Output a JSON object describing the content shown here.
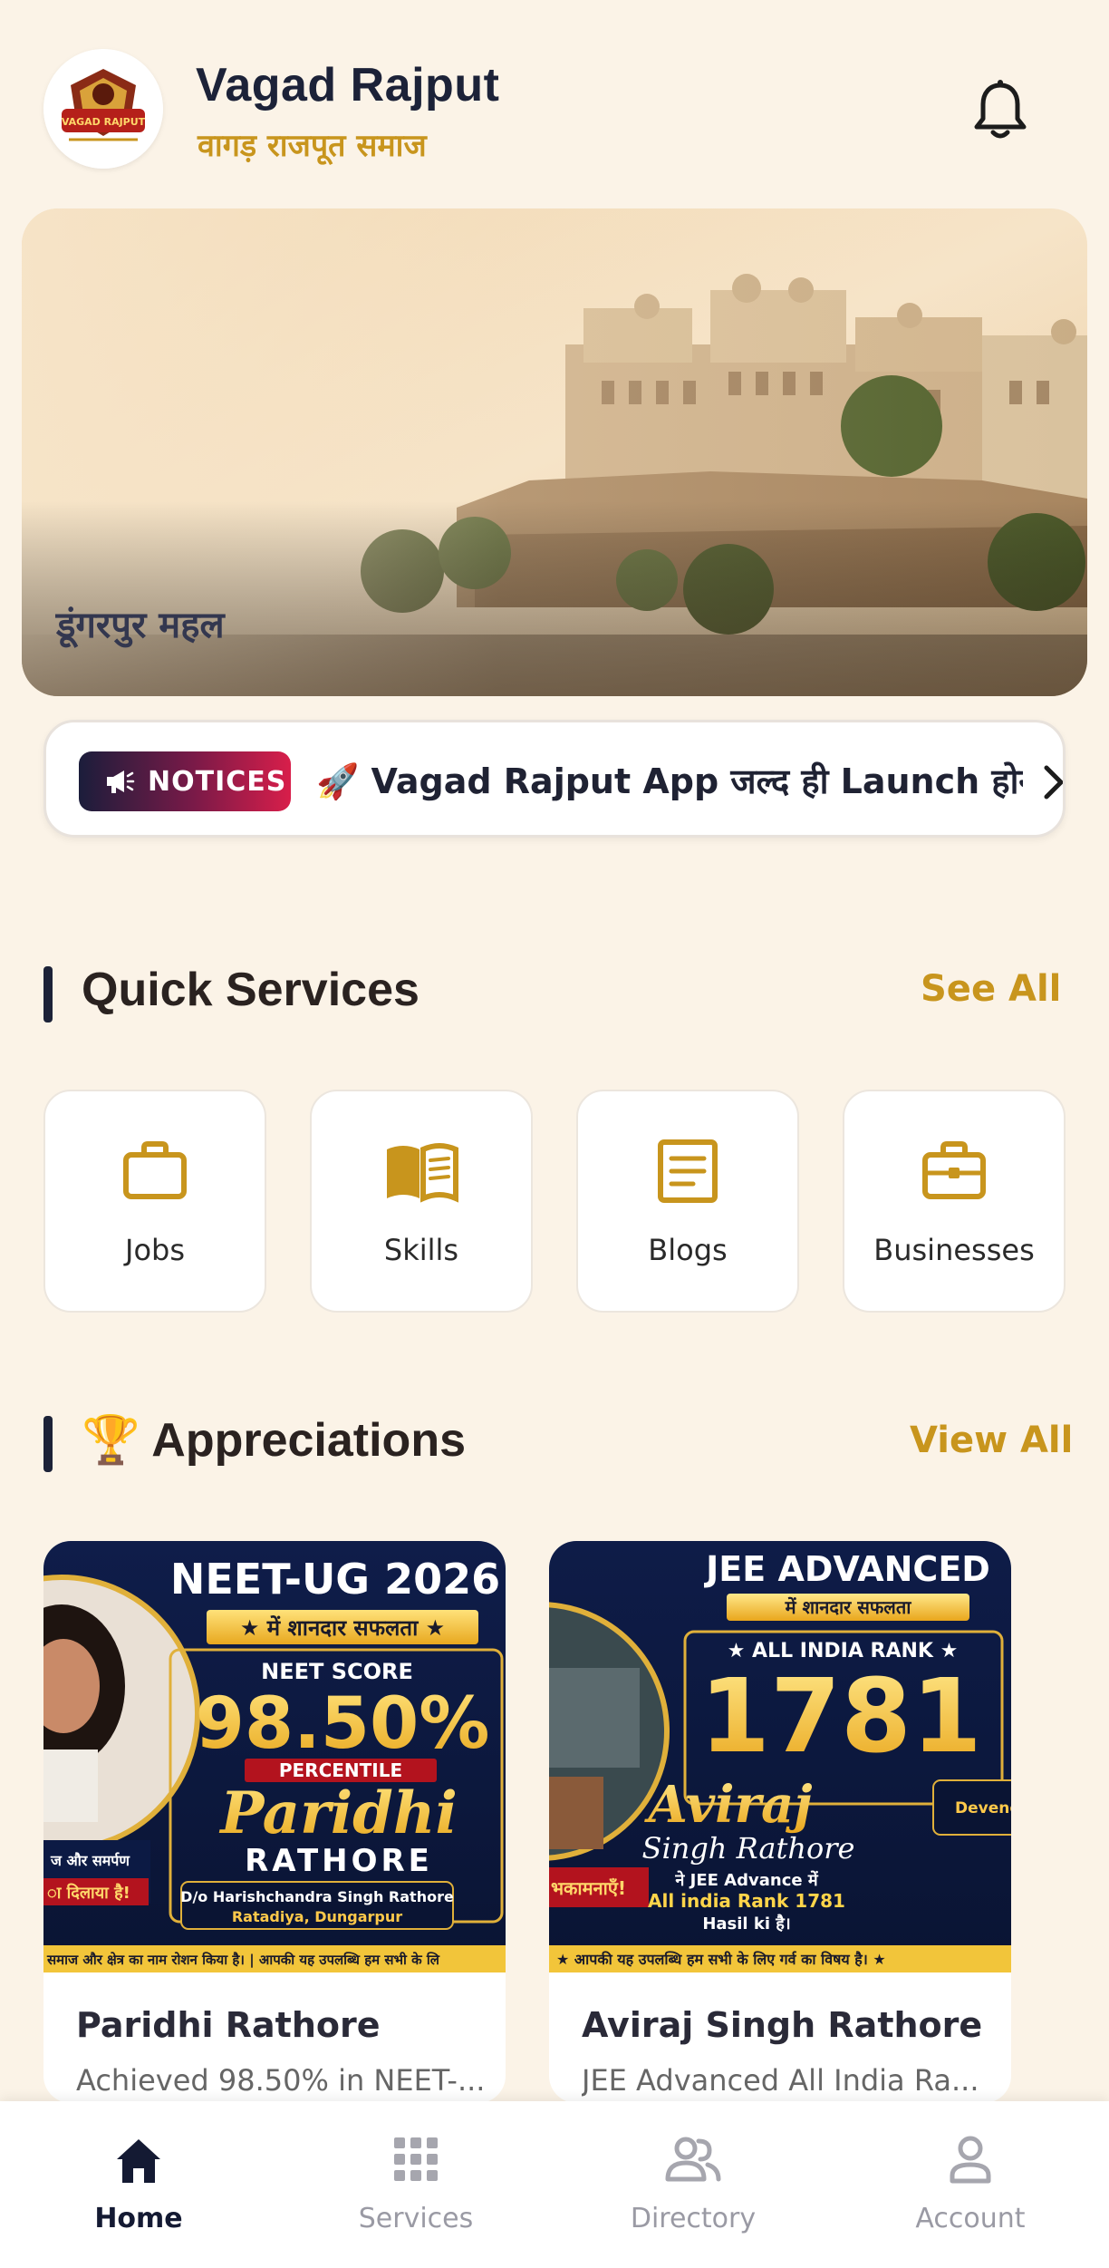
{
  "header": {
    "title": "Vagad Rajput",
    "subtitle": "वागड़ राजपूत समाज",
    "logo_text": "VAGAD RAJPUT",
    "notification_icon": "bell-icon"
  },
  "banner": {
    "caption": "डूंगरपुर महल"
  },
  "notices": {
    "label": "NOTICES",
    "text": "🚀 Vagad Rajput App जल्द ही Launch होने वाला है",
    "icon": "megaphone-icon",
    "next_icon": "chevron-right-icon"
  },
  "quick_services": {
    "title": "Quick Services",
    "link": "See All",
    "items": [
      {
        "label": "Jobs",
        "icon": "briefcase-icon"
      },
      {
        "label": "Skills",
        "icon": "book-icon"
      },
      {
        "label": "Blogs",
        "icon": "document-icon"
      },
      {
        "label": "Businesses",
        "icon": "business-case-icon"
      }
    ]
  },
  "appreciations": {
    "title": "🏆 Appreciations",
    "link": "View All",
    "cards": [
      {
        "name": "Paridhi Rathore",
        "description": "Achieved 98.50% in NEET-...",
        "poster": {
          "headline": "NEET-UG 2026",
          "ribbon": "★ में शानदार सफलता ★",
          "score_label": "NEET SCORE",
          "score": "98.50%",
          "score_tag": "PERCENTILE",
          "first_name": "Paridhi",
          "last_name": "RATHORE",
          "parent": "D/o Harishchandra Singh Rathore",
          "place": "Ratadiya, Dungarpur",
          "side_text": "ज और समर्पण",
          "side_ribbon": "ा दिलाया है!",
          "footer": "समाज और क्षेत्र का नाम रोशन किया है। | आपकी यह उपलब्धि हम सभी के लि"
        }
      },
      {
        "name": "Aviraj Singh Rathore ( ...",
        "description": "JEE Advanced All India Ra...",
        "poster": {
          "headline": "JEE ADVANCED",
          "ribbon": "में शानदार सफलता",
          "score_label": "★ ALL INDIA RANK ★",
          "score": "1781",
          "first_name": "Aviraj",
          "last_name": "Singh Rathore",
          "line1": "ने JEE Advance में",
          "line2": "All india Rank 1781",
          "line3": "Hasil ki है।",
          "side_ribbon": "भकामनाएँ!",
          "side_right": "Devend",
          "footer": "★ आपकी यह उपलब्धि हम सभी के लिए गर्व का विषय है। ★"
        }
      }
    ]
  },
  "bottom_nav": {
    "items": [
      {
        "label": "Home",
        "icon": "home-icon",
        "active": true
      },
      {
        "label": "Services",
        "icon": "grid-icon",
        "active": false
      },
      {
        "label": "Directory",
        "icon": "people-icon",
        "active": false
      },
      {
        "label": "Account",
        "icon": "user-icon",
        "active": false
      }
    ]
  },
  "colors": {
    "background": "#fbf3e7",
    "accent_gold": "#c8951d",
    "navy": "#1c2238",
    "notice_gradient_start": "#1b1d3b",
    "notice_gradient_end": "#d81e4a"
  }
}
